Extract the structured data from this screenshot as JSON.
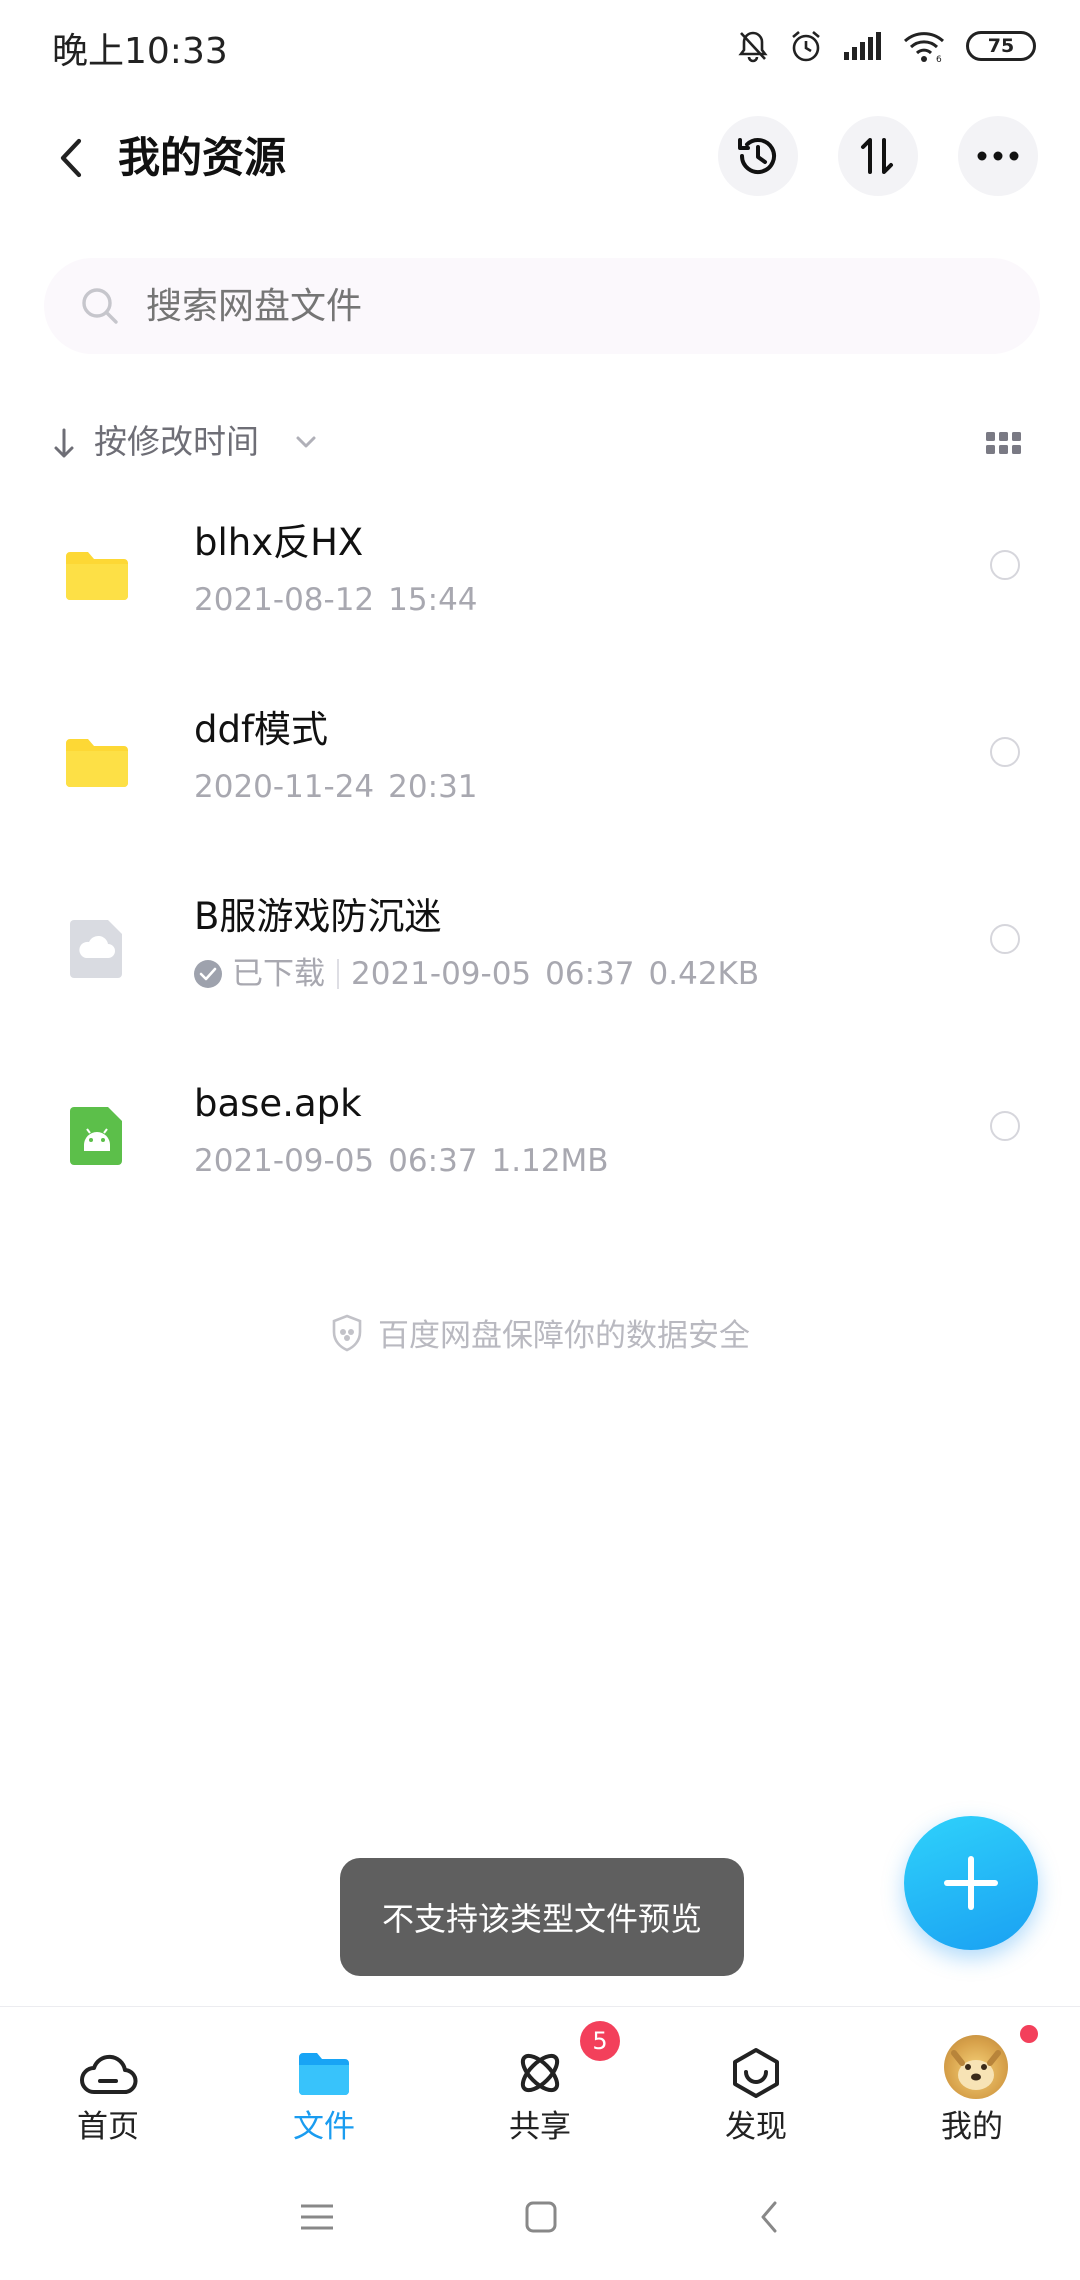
{
  "status_bar": {
    "time": "晚上10:33",
    "battery": "75",
    "icons": [
      "mute-bell-icon",
      "alarm-icon",
      "signal-icon",
      "wifi-icon",
      "battery-icon"
    ]
  },
  "header": {
    "title": "我的资源",
    "actions": [
      "history-icon",
      "transfer-icon",
      "more-icon"
    ]
  },
  "search": {
    "placeholder": "搜索网盘文件"
  },
  "sort": {
    "label": "按修改时间"
  },
  "files": [
    {
      "name": "blhx反HX",
      "date": "2021-08-12",
      "time": "15:44",
      "type": "folder"
    },
    {
      "name": "ddf模式",
      "date": "2020-11-24",
      "time": "20:31",
      "type": "folder"
    },
    {
      "name": "B服游戏防沉迷",
      "status": "已下载",
      "date": "2021-09-05",
      "time": "06:37",
      "size": "0.42KB",
      "type": "cloud-file"
    },
    {
      "name": "base.apk",
      "date": "2021-09-05",
      "time": "06:37",
      "size": "1.12MB",
      "type": "apk"
    }
  ],
  "safety_notice": "百度网盘保障你的数据安全",
  "toast": "不支持该类型文件预览",
  "bottom_nav": {
    "items": [
      {
        "label": "首页",
        "icon": "cloud-home-icon"
      },
      {
        "label": "文件",
        "icon": "folder-icon",
        "active": true
      },
      {
        "label": "共享",
        "icon": "share-atom-icon",
        "badge": "5"
      },
      {
        "label": "发现",
        "icon": "discover-icon"
      },
      {
        "label": "我的",
        "icon": "avatar-icon"
      }
    ]
  },
  "colors": {
    "accent": "#1a9cf0",
    "folder": "#fdd835",
    "apk": "#5cbf4a",
    "badge": "#f3405b",
    "toast_bg": "#5f5f5f"
  }
}
